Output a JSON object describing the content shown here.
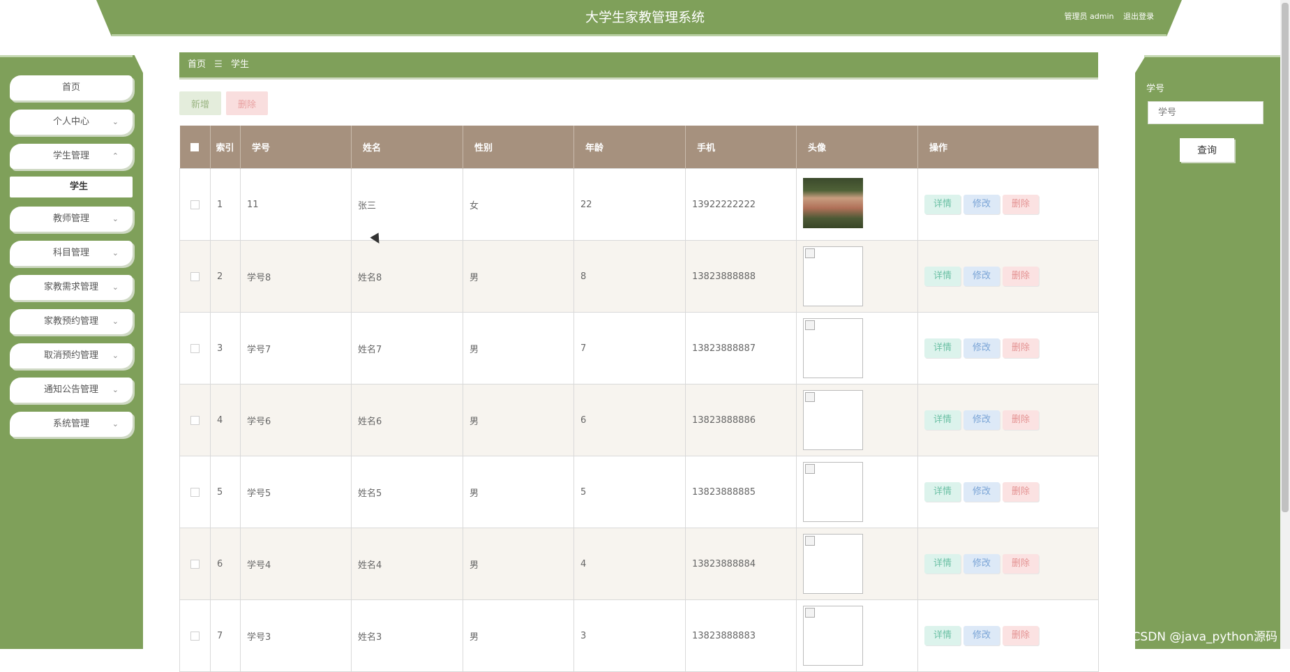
{
  "header": {
    "title": "大学生家教管理系统",
    "admin_label": "管理员 admin",
    "logout_label": "退出登录"
  },
  "sidebar": {
    "items": [
      {
        "label": "首页",
        "chevron": ""
      },
      {
        "label": "个人中心",
        "chevron": "⌄"
      },
      {
        "label": "学生管理",
        "chevron": "⌃"
      },
      {
        "label": "教师管理",
        "chevron": "⌄"
      },
      {
        "label": "科目管理",
        "chevron": "⌄"
      },
      {
        "label": "家教需求管理",
        "chevron": "⌄"
      },
      {
        "label": "家教预约管理",
        "chevron": "⌄"
      },
      {
        "label": "取消预约管理",
        "chevron": "⌄"
      },
      {
        "label": "通知公告管理",
        "chevron": "⌄"
      },
      {
        "label": "系统管理",
        "chevron": "⌄"
      }
    ],
    "sub_item": "学生"
  },
  "breadcrumb": {
    "home": "首页",
    "separator": "☰",
    "current": "学生"
  },
  "actions": {
    "add_label": "新增",
    "delete_label": "删除"
  },
  "search": {
    "label": "学号",
    "placeholder": "学号",
    "button_label": "查询"
  },
  "table": {
    "headers": {
      "index": "索引",
      "student_id": "学号",
      "name": "姓名",
      "gender": "性别",
      "age": "年龄",
      "phone": "手机",
      "avatar": "头像",
      "actions": "操作"
    },
    "op_labels": {
      "detail": "详情",
      "edit": "修改",
      "delete": "删除"
    },
    "rows": [
      {
        "index": "1",
        "student_id": "11",
        "name": "张三",
        "gender": "女",
        "age": "22",
        "phone": "13922222222",
        "avatar": "photo"
      },
      {
        "index": "2",
        "student_id": "学号8",
        "name": "姓名8",
        "gender": "男",
        "age": "8",
        "phone": "13823888888",
        "avatar": "broken"
      },
      {
        "index": "3",
        "student_id": "学号7",
        "name": "姓名7",
        "gender": "男",
        "age": "7",
        "phone": "13823888887",
        "avatar": "broken"
      },
      {
        "index": "4",
        "student_id": "学号6",
        "name": "姓名6",
        "gender": "男",
        "age": "6",
        "phone": "13823888886",
        "avatar": "broken"
      },
      {
        "index": "5",
        "student_id": "学号5",
        "name": "姓名5",
        "gender": "男",
        "age": "5",
        "phone": "13823888885",
        "avatar": "broken"
      },
      {
        "index": "6",
        "student_id": "学号4",
        "name": "姓名4",
        "gender": "男",
        "age": "4",
        "phone": "13823888884",
        "avatar": "broken"
      },
      {
        "index": "7",
        "student_id": "学号3",
        "name": "姓名3",
        "gender": "男",
        "age": "3",
        "phone": "13823888883",
        "avatar": "broken"
      }
    ]
  },
  "watermark": "CSDN @java_python源码",
  "colors": {
    "primary_green": "#7fa05a",
    "table_header": "#a6917e"
  }
}
